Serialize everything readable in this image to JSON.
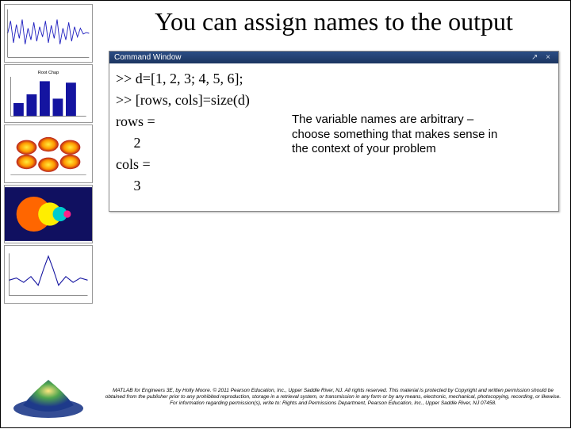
{
  "title": "You can assign names to the output",
  "command_window": {
    "title": "Command Window",
    "lines": [
      ">> d=[1, 2, 3; 4, 5, 6];",
      ">> [rows, cols]=size(d)",
      "rows =",
      "     2",
      "cols =",
      "     3"
    ]
  },
  "note": "The variable names are arbitrary – choose something that makes sense in the context of your problem",
  "footer": "MATLAB for Engineers 3E, by Holly Moore. © 2011 Pearson Education, Inc., Upper Saddle River, NJ. All rights reserved. This material is protected by Copyright and written permission should be obtained from the publisher prior to any prohibited reproduction, storage in a retrieval system, or transmission in any form or by any means, electronic, mechanical, photocopying, recording, or likewise. For information regarding permission(s), write to: Rights and Permissions Department, Pearson Education, Inc., Upper Saddle River, NJ 07458.",
  "sidebar_thumbs": [
    "noisy-signal-plot",
    "bar-chart",
    "surface-3d",
    "fractal-image",
    "sinc-curve"
  ]
}
